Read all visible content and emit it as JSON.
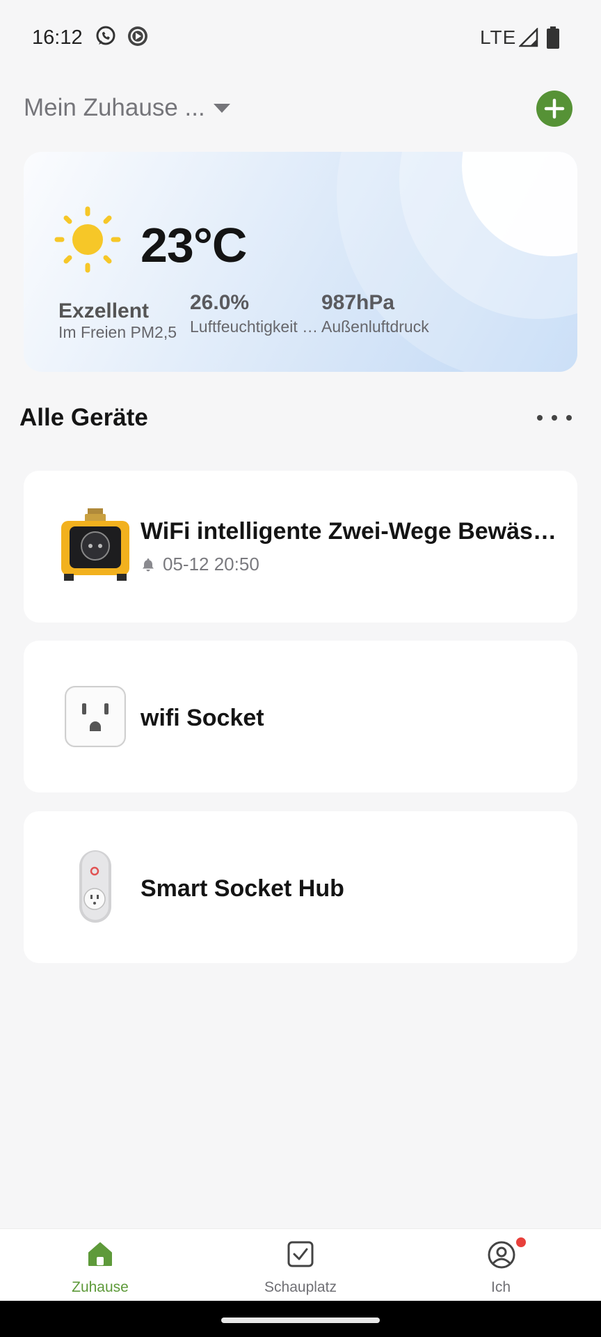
{
  "status_bar": {
    "time": "16:12",
    "network": "LTE",
    "icons": [
      "whatsapp-icon",
      "media-icon",
      "signal-icon",
      "battery-icon"
    ]
  },
  "header": {
    "home_name": "Mein Zuhause ...",
    "add_button_color": "#569236"
  },
  "weather": {
    "temperature": "23°C",
    "condition_icon": "sun-icon",
    "air_quality": {
      "value": "Exzellent",
      "label": "Im Freien PM2,5"
    },
    "humidity": {
      "value": "26.0%",
      "label": "Luftfeuchtigkeit im Freien"
    },
    "pressure": {
      "value": "987hPa",
      "label": "Außenluftdruck"
    }
  },
  "devices_section": {
    "title": "Alle Geräte",
    "items": [
      {
        "name": "WiFi intelligente Zwei-Wege Bewässerung",
        "alarm_time": "05-12 20:50",
        "icon": "water-timer-icon"
      },
      {
        "name": "wifi Socket",
        "icon": "socket-icon"
      },
      {
        "name": "Smart Socket Hub",
        "icon": "plug-hub-icon"
      }
    ]
  },
  "bottom_nav": {
    "items": [
      {
        "label": "Zuhause",
        "icon": "home-icon",
        "active": true
      },
      {
        "label": "Schauplatz",
        "icon": "scene-checkbox-icon",
        "active": false
      },
      {
        "label": "Ich",
        "icon": "profile-icon",
        "active": false,
        "badge": true
      }
    ],
    "active_color": "#5e9a3a"
  }
}
